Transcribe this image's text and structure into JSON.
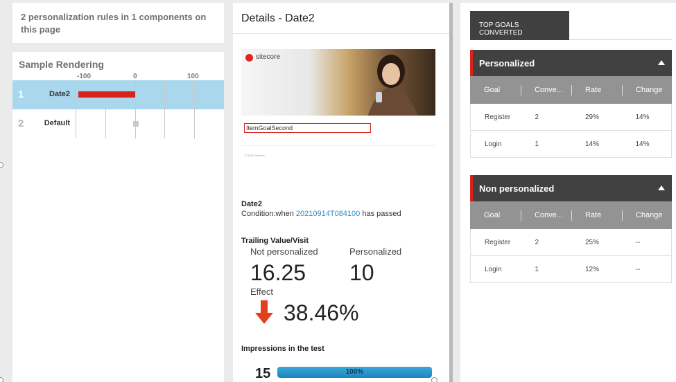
{
  "summary": {
    "text": "2 personalization rules in 1 components on this page"
  },
  "rendering": {
    "title": "Sample Rendering",
    "ticks": [
      "-100",
      "0",
      "100"
    ],
    "rows": [
      {
        "number": "1",
        "name": "Date2",
        "selected": true
      },
      {
        "number": "2",
        "name": "Default",
        "selected": false
      }
    ]
  },
  "details": {
    "title": "Details - Date2",
    "preview": {
      "logo_text": "sitecore",
      "goal_label": "ItemGoalSecond",
      "copyright": "© 2021 Sitecore"
    },
    "condition": {
      "title": "Date2",
      "prefix": "Condition:when",
      "link": "20210914T084100",
      "suffix": "has passed"
    },
    "trailing": {
      "title": "Trailing Value/Visit",
      "not_personalized_label": "Not personalized",
      "not_personalized_value": "16.25",
      "personalized_label": "Personalized",
      "personalized_value": "10",
      "effect_label": "Effect",
      "effect_value": "38.46%"
    },
    "impressions": {
      "title": "Impressions in the test",
      "count": "15",
      "percent_label": "100%",
      "fraction": 1.0
    }
  },
  "goals": {
    "tab_label": "TOP GOALS CONVERTED",
    "columns": [
      "Goal",
      "Conve...",
      "Rate",
      "Change"
    ],
    "groups": [
      {
        "title": "Personalized",
        "rows": [
          [
            "Register",
            "2",
            "29%",
            "14%"
          ],
          [
            "Login",
            "1",
            "14%",
            "14%"
          ]
        ]
      },
      {
        "title": "Non personalized",
        "rows": [
          [
            "Register",
            "2",
            "25%",
            "--"
          ],
          [
            "Login",
            "1",
            "12%",
            "--"
          ]
        ]
      }
    ]
  },
  "colors": {
    "accent_red": "#d9221c",
    "selected_row": "#a9d8ee",
    "link": "#2a8fc7",
    "header_dark": "#414141"
  }
}
